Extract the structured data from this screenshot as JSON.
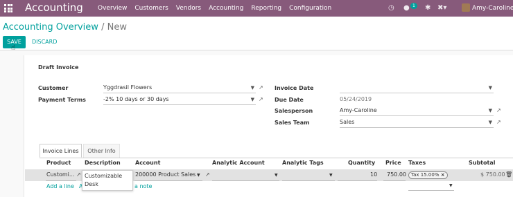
{
  "topbar": {
    "brand": "Accounting",
    "menu": [
      "Overview",
      "Customers",
      "Vendors",
      "Accounting",
      "Reporting",
      "Configuration"
    ],
    "message_count": "1",
    "user": "Amy-Caroline (s",
    "icons": [
      "apps-grid-icon",
      "clock-icon",
      "chat-icon",
      "bug-icon",
      "tools-icon"
    ]
  },
  "control": {
    "breadcrumb_parent": "Accounting Overview",
    "breadcrumb_sep": "/",
    "breadcrumb_current": "New",
    "save_label": "SAVE",
    "discard_label": "DISCARD"
  },
  "form": {
    "status_title": "Draft Invoice",
    "customer_label": "Customer",
    "customer_value": "Yggdrasil Flowers",
    "payment_terms_label": "Payment Terms",
    "payment_terms_value": "-2% 10 days or 30 days",
    "invoice_date_label": "Invoice Date",
    "invoice_date_value": "",
    "due_date_label": "Due Date",
    "due_date_value": "05/24/2019",
    "salesperson_label": "Salesperson",
    "salesperson_value": "Amy-Caroline",
    "sales_team_label": "Sales Team",
    "sales_team_value": "Sales"
  },
  "tabs": [
    "Invoice Lines",
    "Other Info"
  ],
  "lines": {
    "headers": {
      "product": "Product",
      "description": "Description",
      "account": "Account",
      "analytic_account": "Analytic Account",
      "analytic_tags": "Analytic Tags",
      "quantity": "Quantity",
      "price": "Price",
      "taxes": "Taxes",
      "subtotal": "Subtotal"
    },
    "row": {
      "product": "Customi...",
      "description": "Customizable",
      "description_line2": "Desk",
      "account": "200000 Product Sales",
      "quantity": "10",
      "price": "750.00",
      "tax": "Tax 15.00%",
      "tax_remove": "×",
      "subtotal": "$ 750.00"
    },
    "add_line": "Add a line",
    "add_section_fragment": "A",
    "add_note_fragment": "a note"
  },
  "colors": {
    "topbar": "#875a7b",
    "accent": "#00a09d"
  }
}
